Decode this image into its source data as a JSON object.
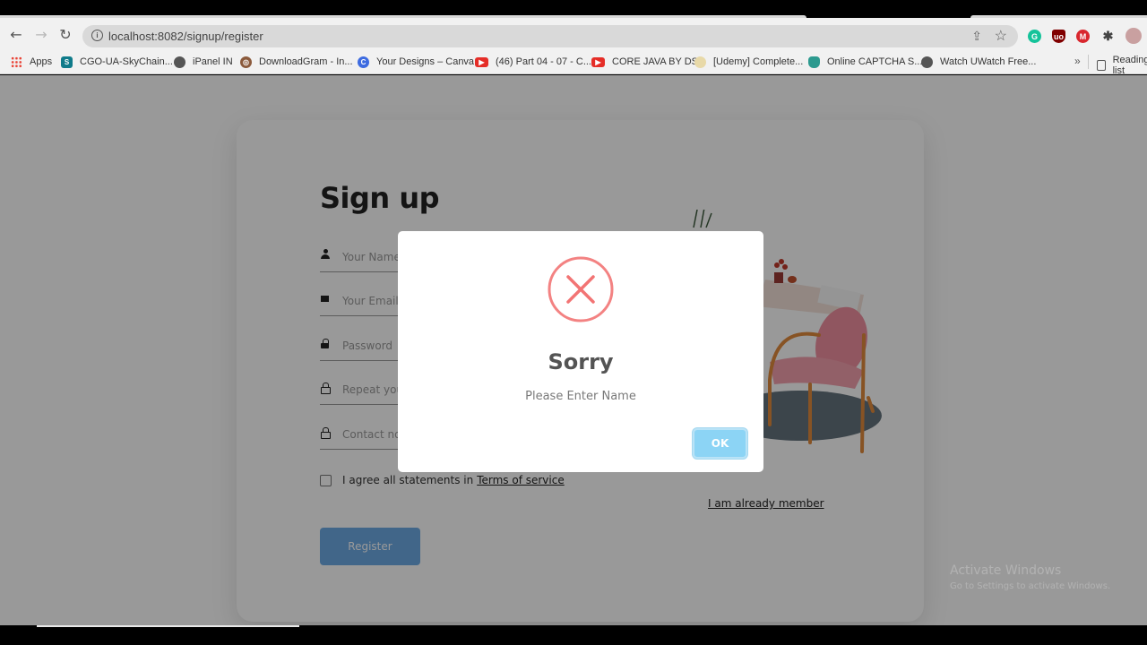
{
  "browser": {
    "url": "localhost:8082/signup/register",
    "bookmarks": [
      {
        "label": "Apps",
        "icon": "apps-grid-icon"
      },
      {
        "label": "CGO-UA-SkyChain...",
        "icon": "sharepoint-icon"
      },
      {
        "label": "iPanel IN",
        "icon": "globe-icon"
      },
      {
        "label": "DownloadGram - In...",
        "icon": "downloadgram-icon"
      },
      {
        "label": "Your Designs – Canva",
        "icon": "canva-icon"
      },
      {
        "label": "(46) Part 04 - 07 - C...",
        "icon": "youtube-icon"
      },
      {
        "label": "CORE JAVA BY DS",
        "icon": "youtube-icon"
      },
      {
        "label": "[Udemy] Complete...",
        "icon": "udemy-icon"
      },
      {
        "label": "Online CAPTCHA S...",
        "icon": "captcha-lock-icon"
      },
      {
        "label": "Watch UWatch Free...",
        "icon": "globe-icon"
      }
    ],
    "overflow_label": "»",
    "reading_list_label": "Reading list",
    "extensions": [
      "grammarly-icon",
      "ublock-icon",
      "mega-icon",
      "puzzle-icon",
      "profile-avatar-icon"
    ]
  },
  "form": {
    "title": "Sign up",
    "fields": [
      {
        "placeholder": "Your Name",
        "value": "",
        "icon": "person-icon"
      },
      {
        "placeholder": "Your Email",
        "value": "",
        "icon": "mail-icon"
      },
      {
        "placeholder": "Password",
        "value": "",
        "icon": "lock-icon"
      },
      {
        "placeholder": "Repeat your password",
        "value": "",
        "icon": "lock-outline-icon"
      },
      {
        "placeholder": "Contact no",
        "value": "",
        "icon": "lock-outline-icon"
      }
    ],
    "agree_text": "I agree all statements in",
    "terms_link": "Terms of service",
    "agree_checked": false,
    "member_link": "I am already member",
    "register_label": "Register"
  },
  "dialog": {
    "icon": "error-x-icon",
    "title": "Sorry",
    "message": "Please Enter Name",
    "ok_label": "OK",
    "accent_color": "#f27474",
    "button_color": "#8cd4f5"
  },
  "watermark": {
    "title": "Activate Windows",
    "subtitle": "Go to Settings to activate Windows."
  }
}
